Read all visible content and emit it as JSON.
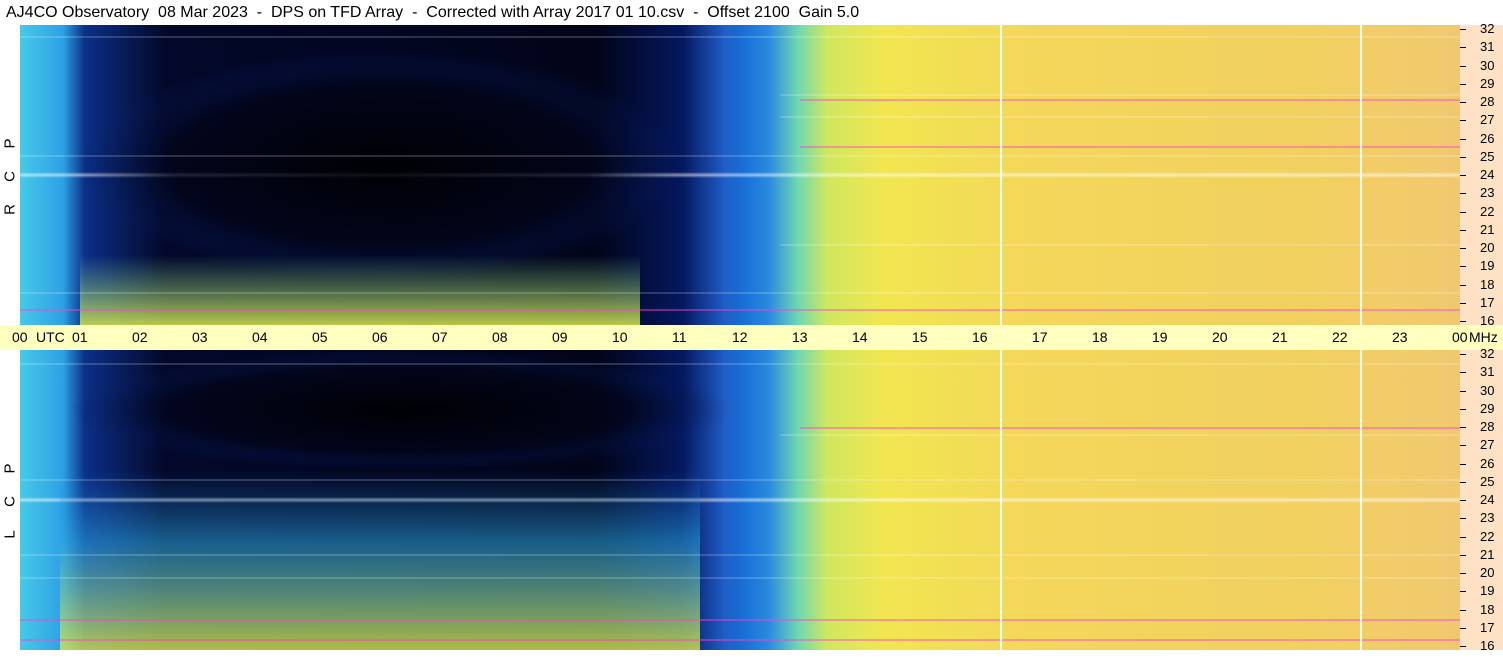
{
  "title": "AJ4CO Observatory  08 Mar 2023  -  DPS on TFD Array  -  Corrected with Array 2017 01 10.csv  -  Offset 2100  Gain 5.0",
  "time_axis": {
    "labels": [
      "00",
      "01",
      "02",
      "03",
      "04",
      "05",
      "06",
      "07",
      "08",
      "09",
      "10",
      "11",
      "12",
      "13",
      "14",
      "15",
      "16",
      "17",
      "18",
      "19",
      "20",
      "21",
      "22",
      "23",
      "00"
    ],
    "utc_label": "UTC",
    "unit_label": "MHz"
  },
  "freq_axis": {
    "labels": [
      "32",
      "31",
      "30",
      "29",
      "28",
      "27",
      "26",
      "25",
      "24",
      "23",
      "22",
      "21",
      "20",
      "19",
      "18",
      "17",
      "16"
    ]
  },
  "panels": [
    {
      "letters": [
        "R",
        "C",
        "P"
      ]
    },
    {
      "letters": [
        "L",
        "C",
        "P"
      ]
    }
  ],
  "chart_data": {
    "type": "heatmap",
    "title": "AJ4CO Observatory  08 Mar 2023  -  DPS on TFD Array  -  Corrected with Array 2017 01 10.csv  -  Offset 2100  Gain 5.0",
    "x": [
      "00",
      "01",
      "02",
      "03",
      "04",
      "05",
      "06",
      "07",
      "08",
      "09",
      "10",
      "11",
      "12",
      "13",
      "14",
      "15",
      "16",
      "17",
      "18",
      "19",
      "20",
      "21",
      "22",
      "23",
      "00"
    ],
    "y": [
      32,
      31,
      30,
      29,
      28,
      27,
      26,
      25,
      24,
      23,
      22,
      21,
      20,
      19,
      18,
      17,
      16
    ],
    "xlabel": "UTC",
    "ylabel": "MHz",
    "panels": [
      "RCP",
      "LCP"
    ]
  }
}
